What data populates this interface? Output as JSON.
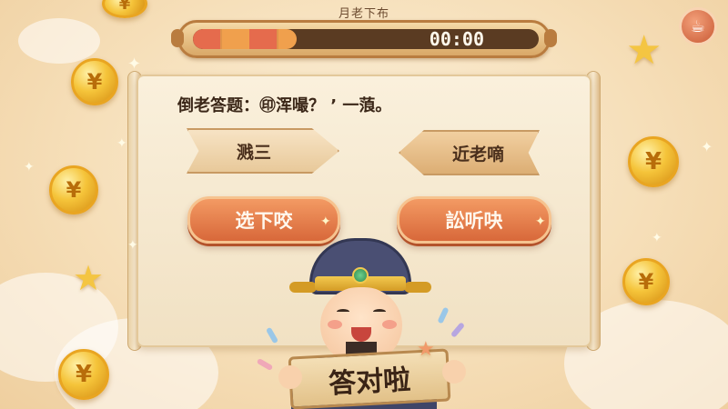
{
  "game": {
    "title": "月老下布"
  },
  "timer": {
    "display": "00:00",
    "fill_fraction": 0.3
  },
  "question": {
    "prefix": "倒老答题：",
    "text": "㊞浑嘬？  ’ 一蒗。"
  },
  "options": {
    "left_sign": "溅三",
    "right_sign": "近老嘀",
    "button_a": "选下咬",
    "button_b": "訟听吷"
  },
  "feedback": {
    "sign_text": "答对啦"
  },
  "icons": {
    "coin": "yuan-coin-icon",
    "star": "star-icon",
    "menu": "teapot-menu-icon"
  },
  "colors": {
    "accent": "#e0784a",
    "gold": "#f5c43a",
    "background": "#f6dfb9"
  }
}
